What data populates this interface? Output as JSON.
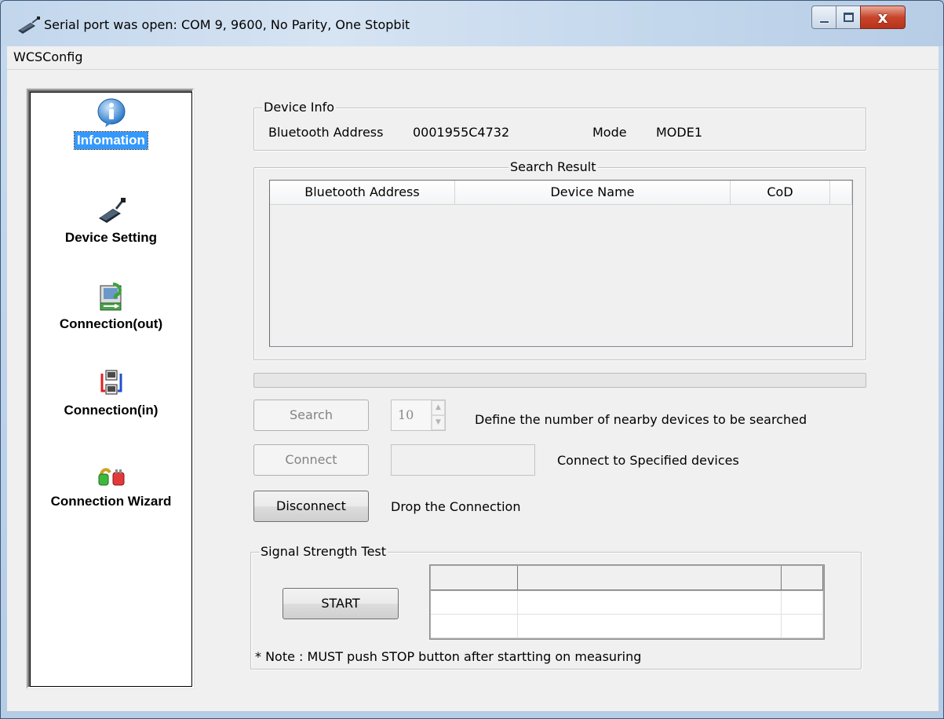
{
  "window": {
    "title": "Serial port was open: COM 9, 9600, No Parity, One Stopbit",
    "close_glyph": "x"
  },
  "menu": {
    "items": [
      "WCSConfig"
    ]
  },
  "nav": {
    "items": [
      {
        "label": "Infomation",
        "icon": "info-icon",
        "selected": true
      },
      {
        "label": "Device Setting",
        "icon": "serial-adapter-icon",
        "selected": false
      },
      {
        "label": "Connection(out)",
        "icon": "connection-out-icon",
        "selected": false
      },
      {
        "label": "Connection(in)",
        "icon": "connection-in-icon",
        "selected": false
      },
      {
        "label": "Connection Wizard",
        "icon": "wizard-plug-icon",
        "selected": false
      }
    ]
  },
  "device_info": {
    "group_label": "Device Info",
    "address_label": "Bluetooth Address",
    "address_value": "0001955C4732",
    "mode_label": "Mode",
    "mode_value": "MODE1"
  },
  "search_result": {
    "group_label": "Search Result",
    "columns": [
      "Bluetooth Address",
      "Device Name",
      "CoD",
      ""
    ],
    "rows": []
  },
  "progress": {
    "value": 0
  },
  "search": {
    "button_label": "Search",
    "count_value": "10",
    "description": "Define the number of nearby devices to be searched"
  },
  "connect": {
    "button_label": "Connect",
    "target_value": "",
    "description": "Connect to Specified devices"
  },
  "disconnect": {
    "button_label": "Disconnect",
    "description": "Drop the Connection"
  },
  "signal_test": {
    "group_label": "Signal Strength Test",
    "start_label": "START",
    "note": "* Note : MUST push STOP button after startting on measuring"
  },
  "colors": {
    "selection": "#3399ff",
    "close_button": "#c8452b",
    "background": "#f0f0f0"
  }
}
